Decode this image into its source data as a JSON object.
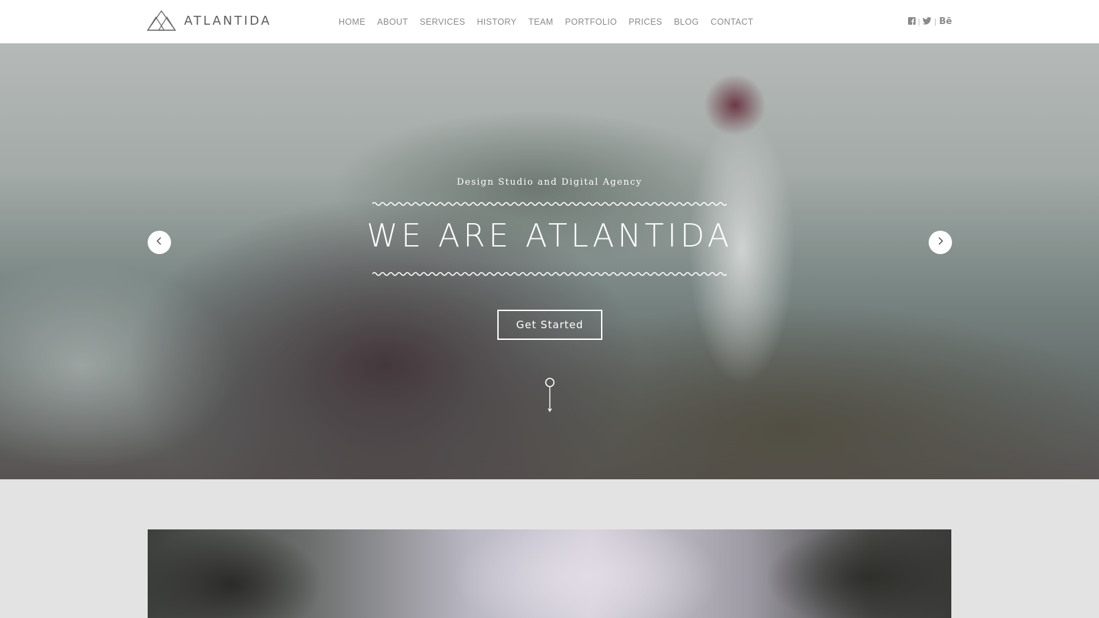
{
  "brand": {
    "name": "ATLANTIDA",
    "logo_icon": "triangles-logo-icon"
  },
  "nav": {
    "items": [
      {
        "label": "HOME"
      },
      {
        "label": "ABOUT"
      },
      {
        "label": "SERVICES"
      },
      {
        "label": "HISTORY"
      },
      {
        "label": "TEAM"
      },
      {
        "label": "PORTFOLIO"
      },
      {
        "label": "PRICES"
      },
      {
        "label": "BLOG"
      },
      {
        "label": "CONTACT"
      }
    ]
  },
  "social": {
    "items": [
      {
        "icon": "facebook-icon"
      },
      {
        "icon": "twitter-icon"
      },
      {
        "icon": "behance-icon",
        "label": "Bē"
      }
    ]
  },
  "hero": {
    "subtitle": "Design Studio and Digital Agency",
    "title": "WE ARE ATLANTIDA",
    "cta_label": "Get Started",
    "prev_icon": "chevron-left-icon",
    "next_icon": "chevron-right-icon"
  },
  "colors": {
    "header_bg": "#ffffff",
    "nav_text": "#8a8a8a",
    "logo_text": "#5e5e5e",
    "hero_text": "#ffffff",
    "page_bg": "#e3e3e3"
  }
}
